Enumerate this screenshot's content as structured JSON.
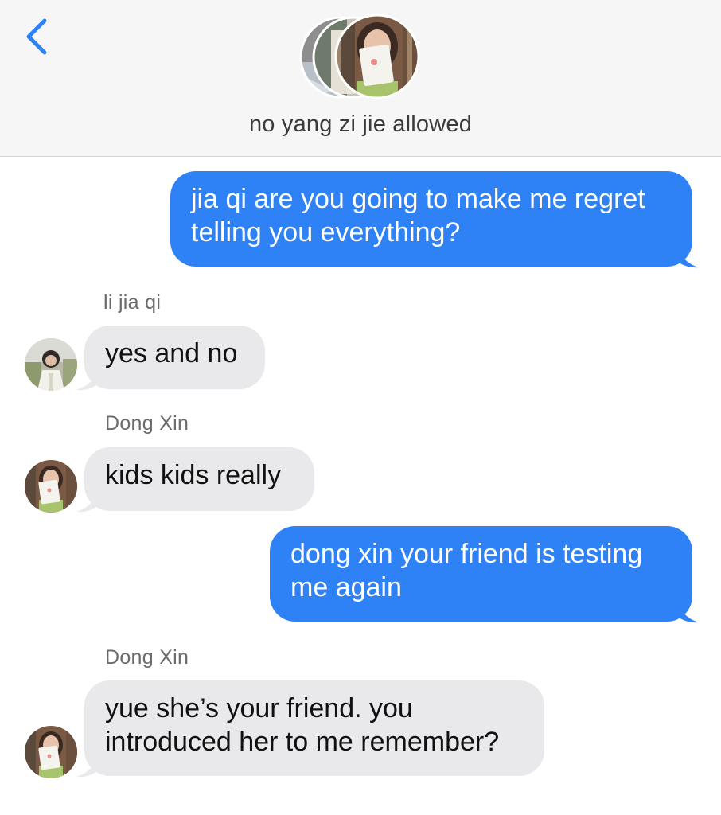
{
  "header": {
    "back_icon": "chevron-left-icon",
    "title": "no yang zi jie allowed",
    "accent_color": "#2e82f6"
  },
  "messages": [
    {
      "direction": "outgoing",
      "lines": [
        "jia qi are you going to make me regret",
        "telling you everything?"
      ]
    },
    {
      "direction": "incoming",
      "sender": "li jia qi",
      "avatar": "li-jia-qi-avatar",
      "lines": [
        "yes and no"
      ]
    },
    {
      "direction": "incoming",
      "sender": "Dong Xin",
      "avatar": "dong-xin-avatar",
      "lines": [
        "kids kids really"
      ]
    },
    {
      "direction": "outgoing",
      "lines": [
        "dong xin your friend is testing",
        "me again"
      ]
    },
    {
      "direction": "incoming",
      "sender": "Dong Xin",
      "avatar": "dong-xin-avatar",
      "lines": [
        "yue she’s your friend. you",
        "introduced her to me remember?"
      ]
    }
  ],
  "colors": {
    "outgoing_bubble": "#2e82f6",
    "incoming_bubble": "#e9e9eb",
    "header_bg": "#f6f6f6"
  }
}
